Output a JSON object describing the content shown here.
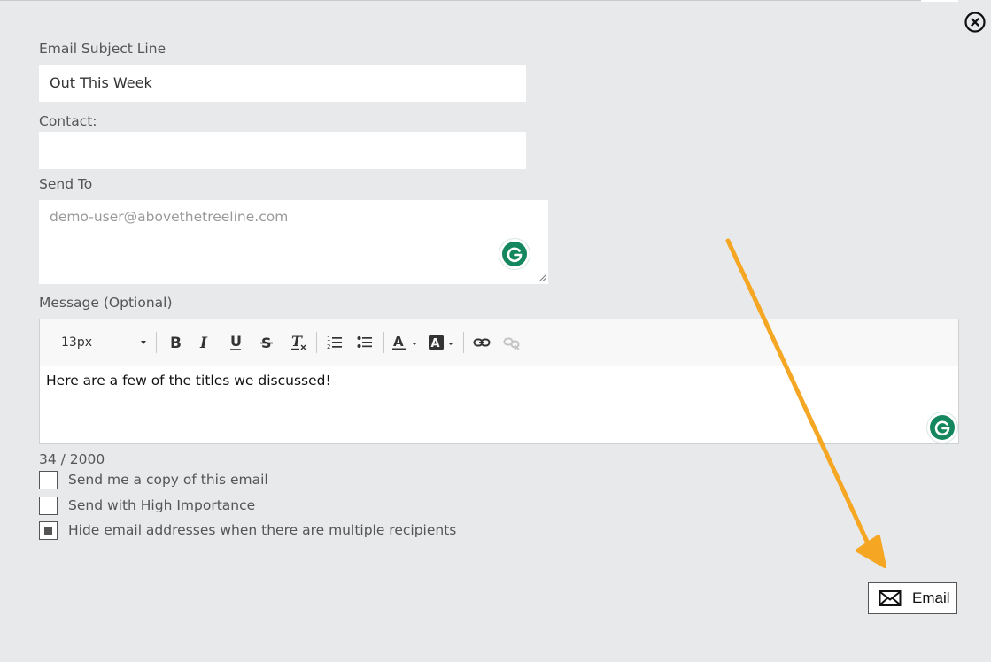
{
  "form": {
    "subject_label": "Email Subject Line",
    "subject_value": "Out This Week",
    "contact_label": "Contact:",
    "contact_value": "",
    "send_to_label": "Send To",
    "send_to_placeholder": "demo-user@abovethetreeline.com",
    "message_label": "Message (Optional)"
  },
  "editor": {
    "font_size": "13px",
    "body_text": "Here are a few of the titles we discussed!",
    "char_count": "34 / 2000",
    "toolbar_icons": [
      "bold-icon",
      "italic-icon",
      "underline-icon",
      "strikethrough-icon",
      "clear-format-icon",
      "ordered-list-icon",
      "unordered-list-icon",
      "text-color-icon",
      "highlight-color-icon",
      "link-icon",
      "unlink-icon"
    ]
  },
  "options": [
    {
      "label": "Send me a copy of this email",
      "checked": false
    },
    {
      "label": "Send with High Importance",
      "checked": false
    },
    {
      "label": "Hide email addresses when there are multiple recipients",
      "checked": true
    }
  ],
  "actions": {
    "email_button": "Email"
  },
  "colors": {
    "background": "#e8e9eb",
    "grammarly_green": "#15875f",
    "annotation_arrow": "#f5a623"
  }
}
